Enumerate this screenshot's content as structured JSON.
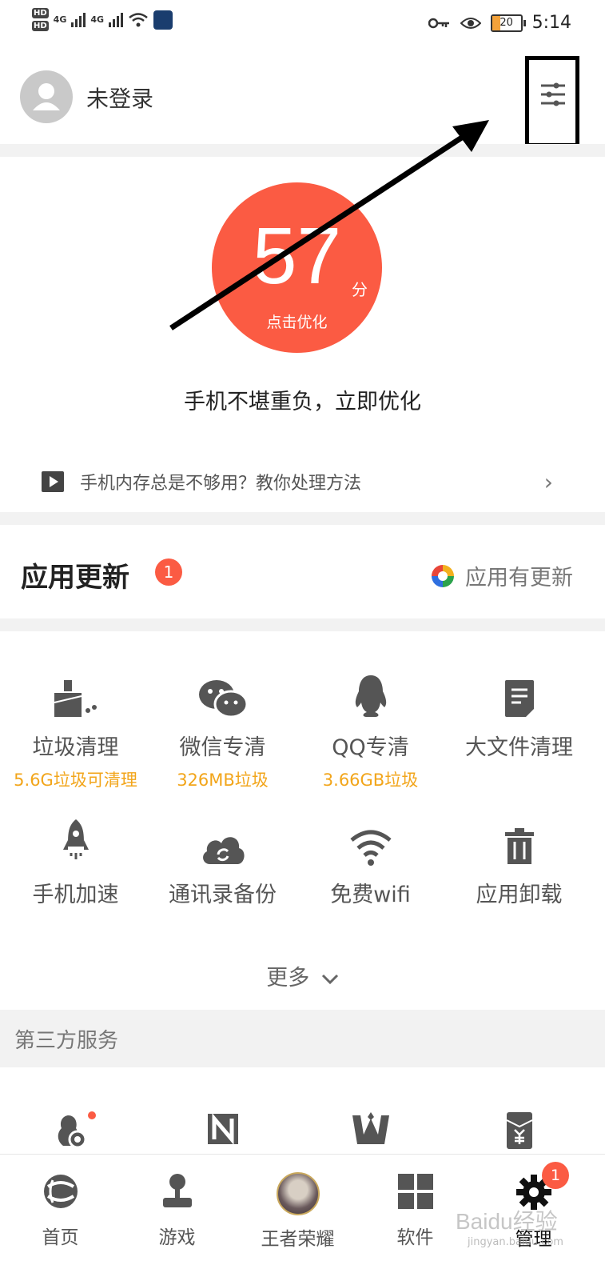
{
  "status_bar": {
    "time": "5:14",
    "battery": "20",
    "network_1": "4G",
    "network_2": "4G"
  },
  "header": {
    "login_label": "未登录"
  },
  "score": {
    "value": "57",
    "unit": "分",
    "action": "点击优化",
    "message": "手机不堪重负，立即优化"
  },
  "tip": {
    "text": "手机内存总是不够用？教你处理方法"
  },
  "updates": {
    "title": "应用更新",
    "badge": "1",
    "right_label": "应用有更新"
  },
  "tools": [
    {
      "name": "垃圾清理",
      "sub": "5.6G垃圾可清理",
      "icon": "broom-icon"
    },
    {
      "name": "微信专清",
      "sub": "326MB垃圾",
      "icon": "wechat-icon"
    },
    {
      "name": "QQ专清",
      "sub": "3.66GB垃圾",
      "icon": "qq-penguin-icon"
    },
    {
      "name": "大文件清理",
      "sub": "",
      "icon": "document-icon"
    },
    {
      "name": "手机加速",
      "sub": "",
      "icon": "rocket-icon"
    },
    {
      "name": "通讯录备份",
      "sub": "",
      "icon": "cloud-sync-icon"
    },
    {
      "name": "免费wifi",
      "sub": "",
      "icon": "wifi-icon"
    },
    {
      "name": "应用卸载",
      "sub": "",
      "icon": "trash-icon"
    }
  ],
  "more_label": "更多",
  "third_party": {
    "title": "第三方服务"
  },
  "nav": [
    {
      "label": "首页",
      "icon": "home-logo-icon"
    },
    {
      "label": "游戏",
      "icon": "joystick-icon"
    },
    {
      "label": "王者荣耀",
      "icon": "game-avatar-icon"
    },
    {
      "label": "软件",
      "icon": "apps-grid-icon"
    },
    {
      "label": "管理",
      "icon": "gear-icon",
      "badge": "1"
    }
  ],
  "watermark": {
    "text": "Baidu经验",
    "sub": "jingyan.baidu.com"
  },
  "colors": {
    "accent": "#fb5b43",
    "yellow": "#f2a51a",
    "icon": "#555555"
  }
}
